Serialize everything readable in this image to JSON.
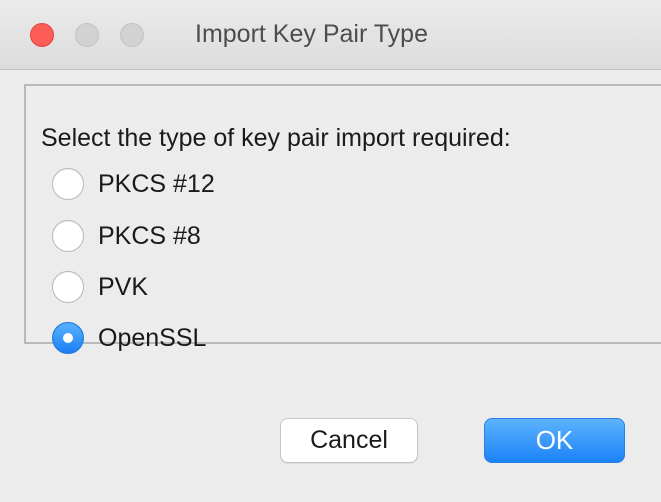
{
  "window": {
    "title": "Import Key Pair Type"
  },
  "prompt": "Select the type of key pair import required:",
  "options": [
    {
      "label": "PKCS #12",
      "selected": false
    },
    {
      "label": "PKCS #8",
      "selected": false
    },
    {
      "label": "PVK",
      "selected": false
    },
    {
      "label": "OpenSSL",
      "selected": true
    }
  ],
  "buttons": {
    "cancel_label": "Cancel",
    "ok_label": "OK"
  },
  "colors": {
    "close": "#fc5d57",
    "accent": "#1b82f8"
  }
}
